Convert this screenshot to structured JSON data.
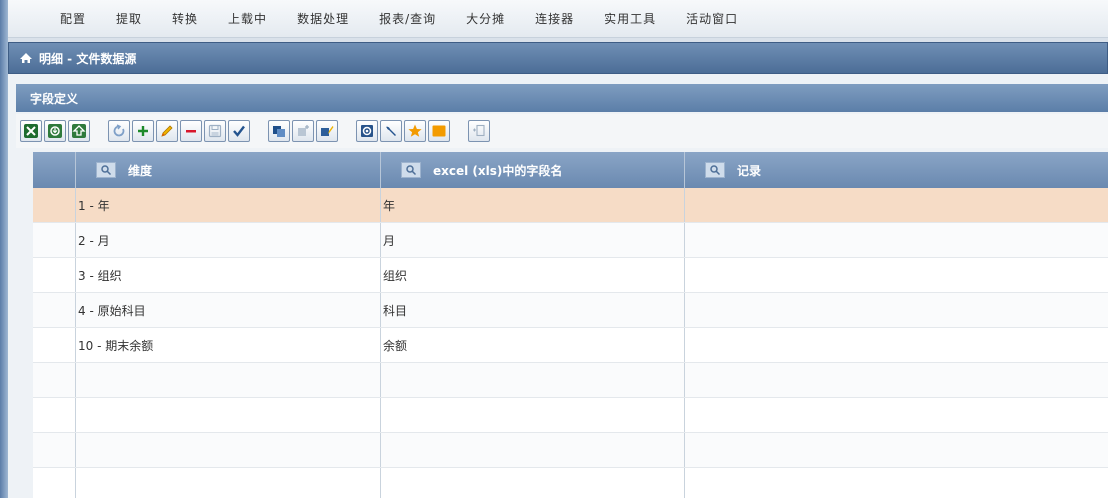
{
  "menu": {
    "items": [
      {
        "label": "配置"
      },
      {
        "label": "提取"
      },
      {
        "label": "转换"
      },
      {
        "label": "上载中"
      },
      {
        "label": "数据处理"
      },
      {
        "label": "报表/查询"
      },
      {
        "label": "大分摊"
      },
      {
        "label": "连接器"
      },
      {
        "label": "实用工具"
      },
      {
        "label": "活动窗口"
      }
    ]
  },
  "panel": {
    "title": "明细 - 文件数据源"
  },
  "section": {
    "title": "字段定义"
  },
  "grid": {
    "columns": [
      "维度",
      "excel (xls)中的字段名",
      "记录"
    ],
    "rows": [
      {
        "dimension": "1 - 年",
        "field": "年",
        "record": ""
      },
      {
        "dimension": "2 - 月",
        "field": "月",
        "record": ""
      },
      {
        "dimension": "3 - 组织",
        "field": "组织",
        "record": ""
      },
      {
        "dimension": "4 - 原始科目",
        "field": "科目",
        "record": ""
      },
      {
        "dimension": "10 - 期末余额",
        "field": "余额",
        "record": ""
      },
      {
        "dimension": "",
        "field": "",
        "record": ""
      },
      {
        "dimension": "",
        "field": "",
        "record": ""
      },
      {
        "dimension": "",
        "field": "",
        "record": ""
      },
      {
        "dimension": "",
        "field": "",
        "record": ""
      }
    ]
  },
  "toolbar": {
    "icons": [
      "excel-icon",
      "import-icon",
      "export-icon",
      "undo-icon",
      "add-icon",
      "edit-icon",
      "delete-icon",
      "save-icon",
      "confirm-icon",
      "copy-icon",
      "paste-icon",
      "paste-edit-icon",
      "settings-icon",
      "tool-icon",
      "star-icon",
      "color-icon",
      "insert-icon"
    ]
  },
  "colors": {
    "header_blue": "#6a89b0",
    "selected_row": "#f6dcc6",
    "accent_orange": "#f39b00"
  }
}
